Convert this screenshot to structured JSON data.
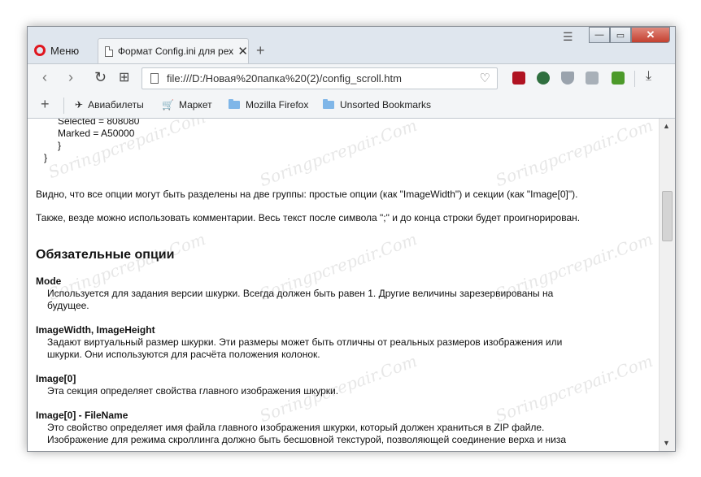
{
  "browser": {
    "menu_label": "Меню",
    "tab_title": "Формат Config.ini для рех",
    "tab_close": "✕",
    "new_tab": "+",
    "address": "file:///D:/Новая%20папка%20(2)/config_scroll.htm",
    "window_controls": {
      "minimize": "—",
      "maximize": "▭",
      "close": "✕"
    }
  },
  "nav": {
    "back": "‹",
    "forward": "›",
    "reload": "↻",
    "speed_dial": "⊞",
    "download": "⤓",
    "heart": "♡"
  },
  "bookmarks": {
    "add": "+",
    "items": [
      {
        "label": "Авиабилеты",
        "icon": "plane-icon"
      },
      {
        "label": "Маркет",
        "icon": "cart-icon"
      },
      {
        "label": "Mozilla Firefox",
        "icon": "folder-icon"
      },
      {
        "label": "Unsorted Bookmarks",
        "icon": "folder-icon"
      }
    ]
  },
  "content": {
    "code_lines": [
      "Selected = 808080",
      "Marked = A50000",
      "}",
      "}"
    ],
    "para1": "Видно, что все опции могут быть разделены на две группы: простые опции (как \"ImageWidth\") и секции (как \"Image[0]\").",
    "para2": "Также, везде можно использовать комментарии. Весь текст после символа \";\" и до конца строки будет проигнорирован.",
    "heading": "Обязательные опции",
    "options": [
      {
        "name": "Mode",
        "lines": [
          "Используется для задания версии шкурки. Всегда должен быть равен 1. Другие величины зарезервированы на",
          "будущее."
        ]
      },
      {
        "name": "ImageWidth, ImageHeight",
        "lines": [
          "Задают виртуальный размер шкурки. Эти размеры может быть отличны от реальных размеров изображения или",
          "шкурки. Они используются для расчёта положения колонок."
        ]
      },
      {
        "name": "Image[0]",
        "lines": [
          "Эта секция определяет свойства главного изображения шкурки."
        ]
      },
      {
        "name": "Image[0] - FileName",
        "lines": [
          "Это свойство определяет имя файла главного изображения шкурки, который должен храниться в ZIP файле.",
          "Изображение для режима скроллинга должно быть бесшовной текстурой, позволяющей соединение верха и низа"
        ]
      }
    ]
  },
  "watermark": "Soringpcrepair.Com",
  "colors": {
    "opera_red": "#e0161f",
    "folder": "#7fb6e8",
    "close": "#c4402f"
  }
}
